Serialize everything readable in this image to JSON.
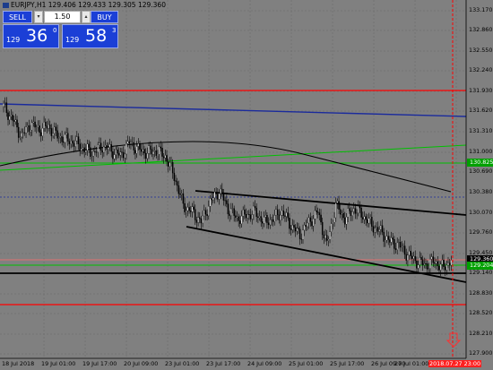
{
  "header": {
    "symbol_line": "EURJPY,H1  129.406 129.433 129.305 129.360"
  },
  "trade_panel": {
    "sell_label": "SELL",
    "buy_label": "BUY",
    "lot_value": "1.50",
    "lot_down_glyph": "▾",
    "lot_up_glyph": "▴",
    "bid": {
      "prefix": "129",
      "big": "36",
      "sup": "0"
    },
    "ask": {
      "prefix": "129",
      "big": "58",
      "sup": "3"
    }
  },
  "price_axis": {
    "labels": [
      "133.170",
      "132.860",
      "132.550",
      "132.240",
      "131.930",
      "131.620",
      "131.310",
      "131.000",
      "130.690",
      "130.380",
      "130.070",
      "129.760",
      "129.450",
      "129.140",
      "128.830",
      "128.520",
      "128.210",
      "127.900"
    ],
    "current_price_tag": "129.360",
    "green_line_tag": "130.825",
    "green_lower_tag": "129.204"
  },
  "time_axis": {
    "labels": [
      "18 Jul 2018",
      "19 Jul 01:00",
      "19 Jul 17:00",
      "20 Jul 09:00",
      "23 Jul 01:00",
      "23 Jul 17:00",
      "24 Jul 09:00",
      "25 Jul 01:00",
      "25 Jul 17:00",
      "26 Jul 09:00",
      "27 Jul 01:00"
    ],
    "cursor_label": "2018.07.27 23:00"
  },
  "colors": {
    "background": "#808080",
    "panel_blue": "#1b3fd6",
    "red_line": "#ff0000",
    "blue_line": "#1a2a9c",
    "green_line": "#00b400",
    "channel": "#000000"
  },
  "chart_data": {
    "type": "candlestick",
    "symbol": "EURJPY",
    "timeframe": "H1",
    "ylim": [
      127.9,
      133.17
    ],
    "close_path": [
      131.65,
      131.45,
      131.2,
      131.38,
      131.3,
      131.35,
      131.2,
      131.15,
      131.1,
      131.0,
      130.95,
      131.05,
      130.98,
      130.9,
      131.1,
      131.0,
      130.95,
      130.98,
      130.9,
      130.6,
      130.15,
      130.05,
      129.9,
      130.2,
      130.38,
      130.1,
      129.95,
      130.0,
      130.05,
      129.9,
      129.95,
      130.05,
      129.85,
      129.7,
      129.9,
      130.05,
      129.55,
      130.15,
      129.95,
      130.1,
      130.0,
      129.85,
      129.75,
      129.6,
      129.55,
      129.4,
      129.3,
      129.25,
      129.3,
      129.2,
      129.36
    ]
  }
}
